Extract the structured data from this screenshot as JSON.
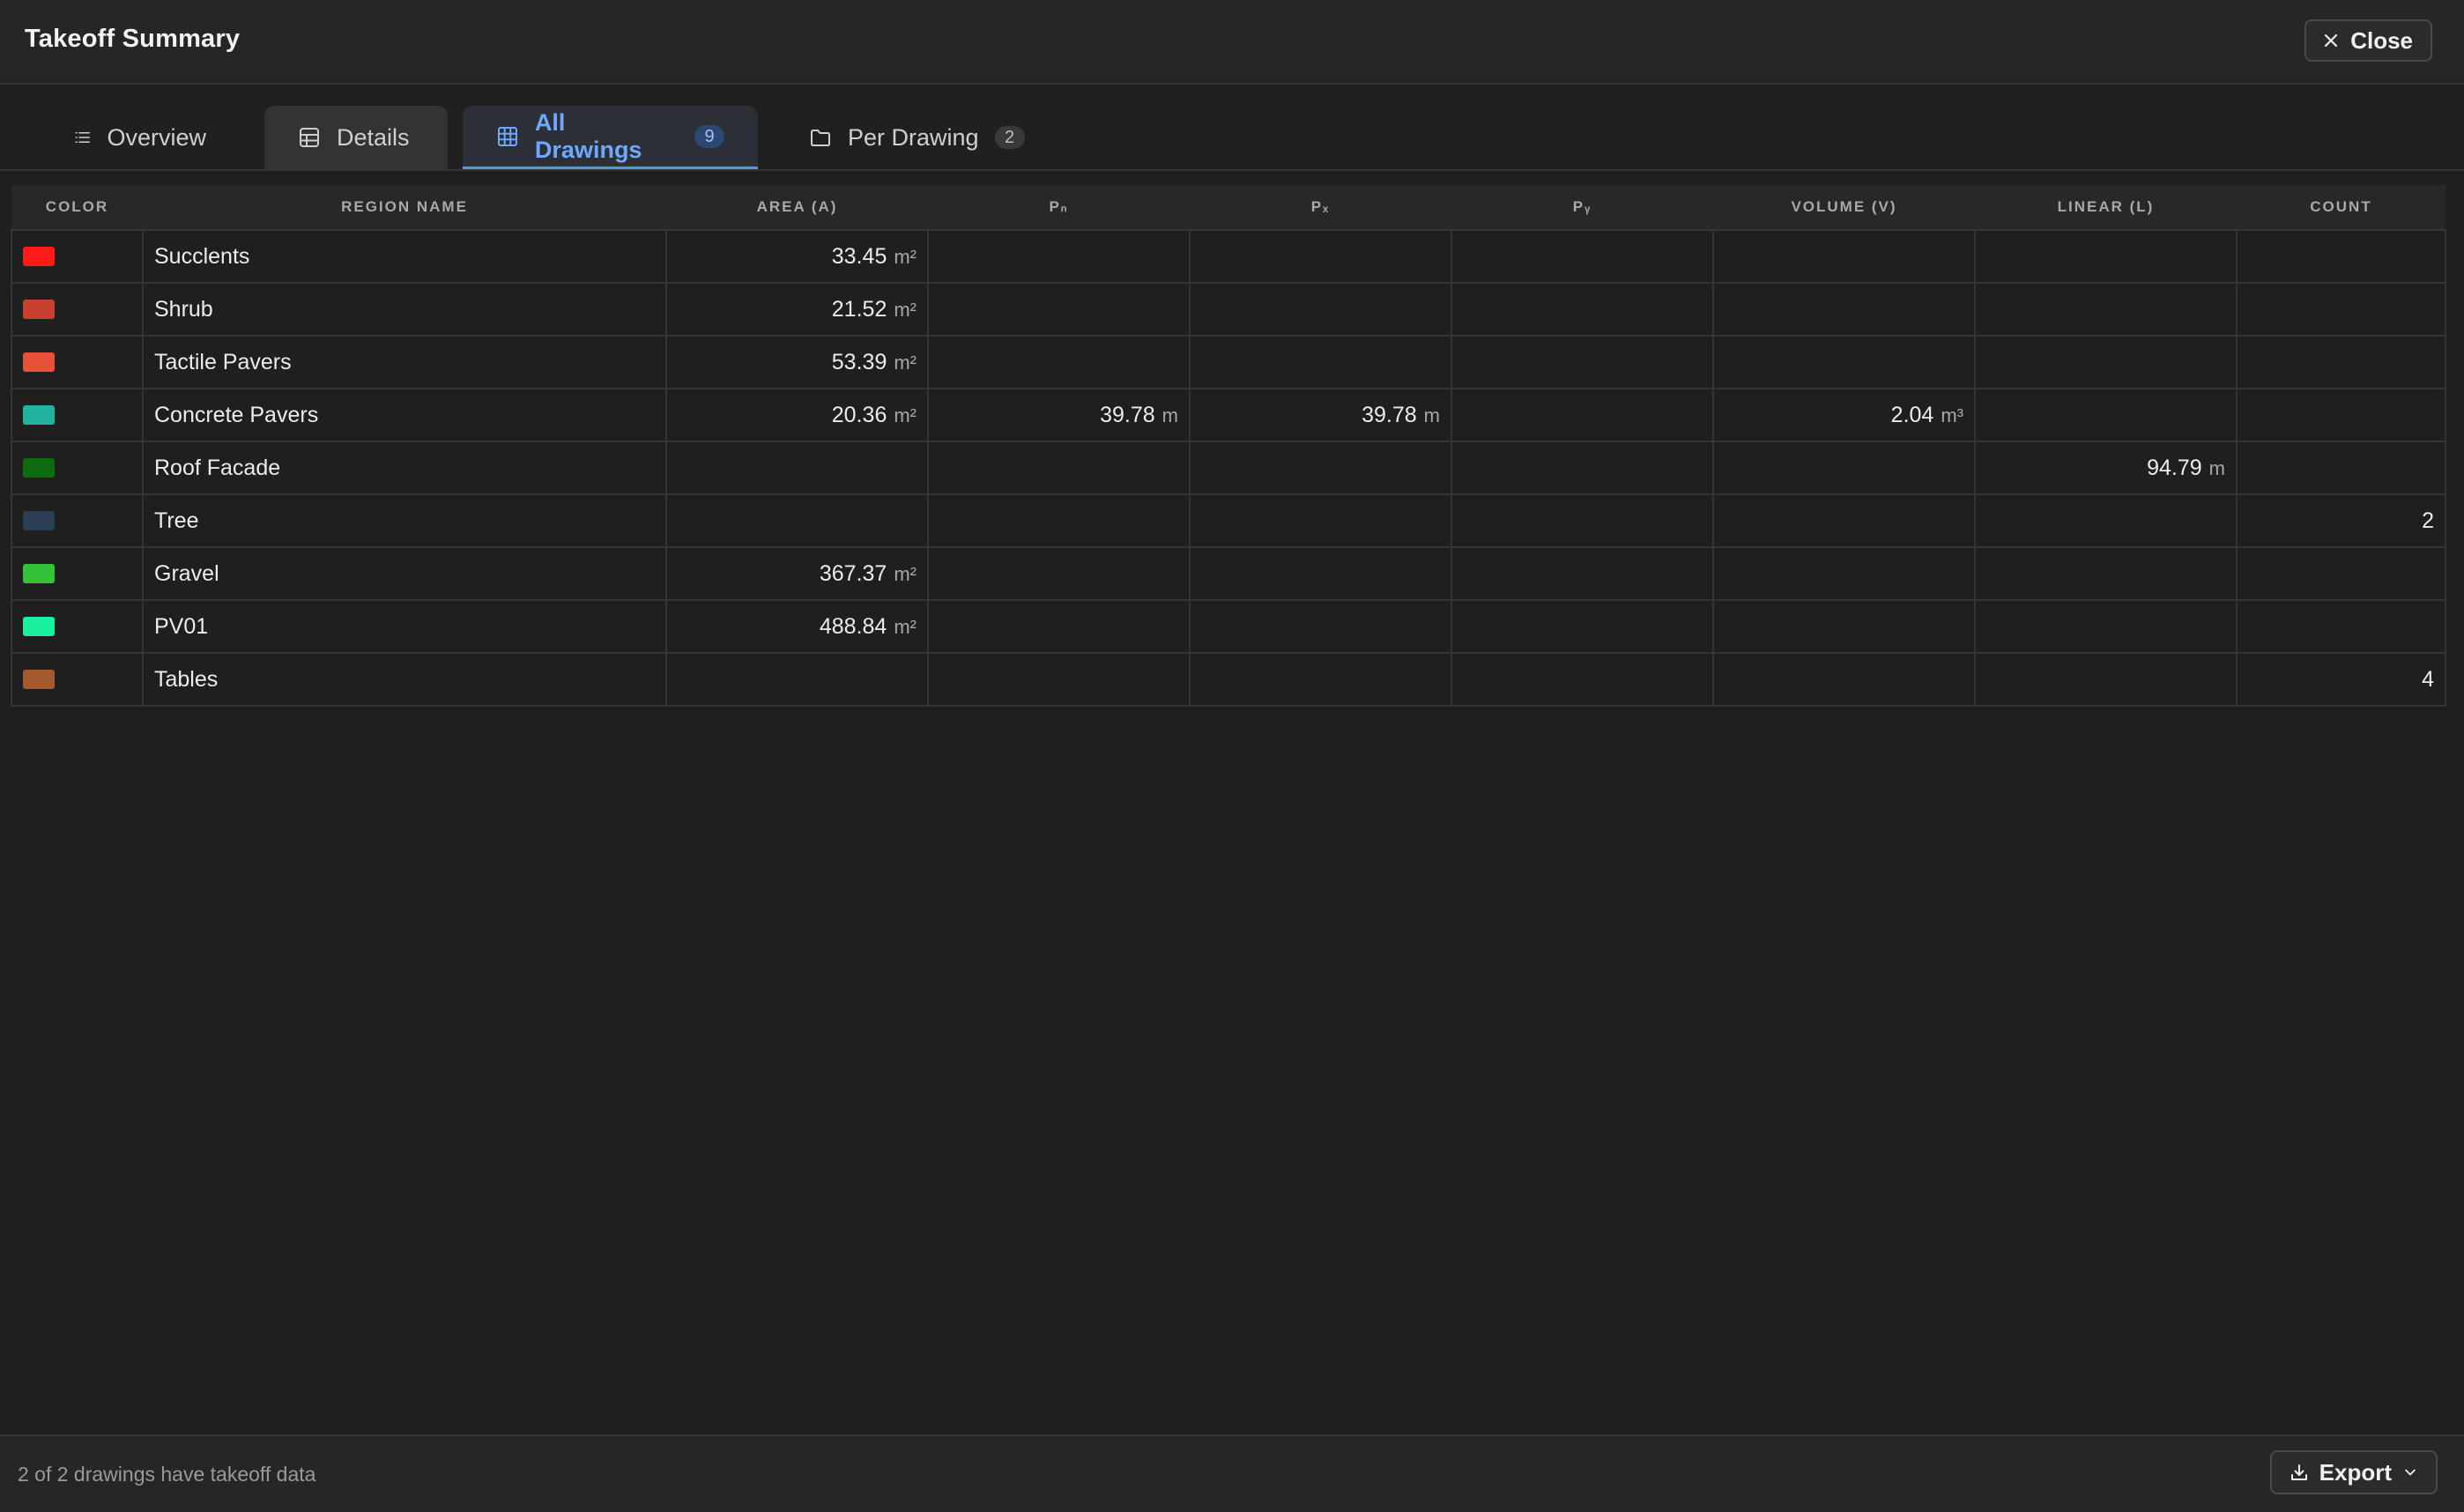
{
  "header": {
    "title": "Takeoff Summary",
    "close_label": "Close"
  },
  "tabs": [
    {
      "label": "Overview",
      "icon": "list-icon"
    },
    {
      "label": "Details",
      "icon": "table-icon"
    },
    {
      "label": "All Drawings",
      "icon": "grid-icon",
      "badge": "9",
      "active": true
    },
    {
      "label": "Per Drawing",
      "icon": "folder-icon",
      "badge": "2"
    }
  ],
  "table": {
    "columns": [
      "COLOR",
      "REGION NAME",
      "AREA (A)",
      "Pₙ",
      "Pₓ",
      "Pᵧ",
      "VOLUME (V)",
      "LINEAR (L)",
      "COUNT"
    ],
    "rows": [
      {
        "color": "#ff1a1a",
        "name": "Succlents",
        "area": "33.45",
        "area_unit": "m²",
        "pn": "",
        "pn_unit": "",
        "px": "",
        "px_unit": "",
        "py": "",
        "volume": "",
        "volume_unit": "",
        "linear": "",
        "linear_unit": "",
        "count": ""
      },
      {
        "color": "#c8412e",
        "name": "Shrub",
        "area": "21.52",
        "area_unit": "m²",
        "pn": "",
        "pn_unit": "",
        "px": "",
        "px_unit": "",
        "py": "",
        "volume": "",
        "volume_unit": "",
        "linear": "",
        "linear_unit": "",
        "count": ""
      },
      {
        "color": "#e8503a",
        "name": "Tactile Pavers",
        "area": "53.39",
        "area_unit": "m²",
        "pn": "",
        "pn_unit": "",
        "px": "",
        "px_unit": "",
        "py": "",
        "volume": "",
        "volume_unit": "",
        "linear": "",
        "linear_unit": "",
        "count": ""
      },
      {
        "color": "#22b3a0",
        "name": "Concrete Pavers",
        "area": "20.36",
        "area_unit": "m²",
        "pn": "39.78",
        "pn_unit": "m",
        "px": "39.78",
        "px_unit": "m",
        "py": "",
        "volume": "2.04",
        "volume_unit": "m³",
        "linear": "",
        "linear_unit": "",
        "count": ""
      },
      {
        "color": "#0f6b0f",
        "name": "Roof Facade",
        "area": "",
        "area_unit": "",
        "pn": "",
        "pn_unit": "",
        "px": "",
        "px_unit": "",
        "py": "",
        "volume": "",
        "volume_unit": "",
        "linear": "94.79",
        "linear_unit": "m",
        "count": ""
      },
      {
        "color": "#2b3e52",
        "name": "Tree",
        "area": "",
        "area_unit": "",
        "pn": "",
        "pn_unit": "",
        "px": "",
        "px_unit": "",
        "py": "",
        "volume": "",
        "volume_unit": "",
        "linear": "",
        "linear_unit": "",
        "count": "2"
      },
      {
        "color": "#34c23a",
        "name": "Gravel",
        "area": "367.37",
        "area_unit": "m²",
        "pn": "",
        "pn_unit": "",
        "px": "",
        "px_unit": "",
        "py": "",
        "volume": "",
        "volume_unit": "",
        "linear": "",
        "linear_unit": "",
        "count": ""
      },
      {
        "color": "#19f0a0",
        "name": "PV01",
        "area": "488.84",
        "area_unit": "m²",
        "pn": "",
        "pn_unit": "",
        "px": "",
        "px_unit": "",
        "py": "",
        "volume": "",
        "volume_unit": "",
        "linear": "",
        "linear_unit": "",
        "count": ""
      },
      {
        "color": "#a35a30",
        "name": "Tables",
        "area": "",
        "area_unit": "",
        "pn": "",
        "pn_unit": "",
        "px": "",
        "px_unit": "",
        "py": "",
        "volume": "",
        "volume_unit": "",
        "linear": "",
        "linear_unit": "",
        "count": "4"
      }
    ]
  },
  "footer": {
    "status": "2 of 2 drawings have takeoff data",
    "export_label": "Export"
  }
}
